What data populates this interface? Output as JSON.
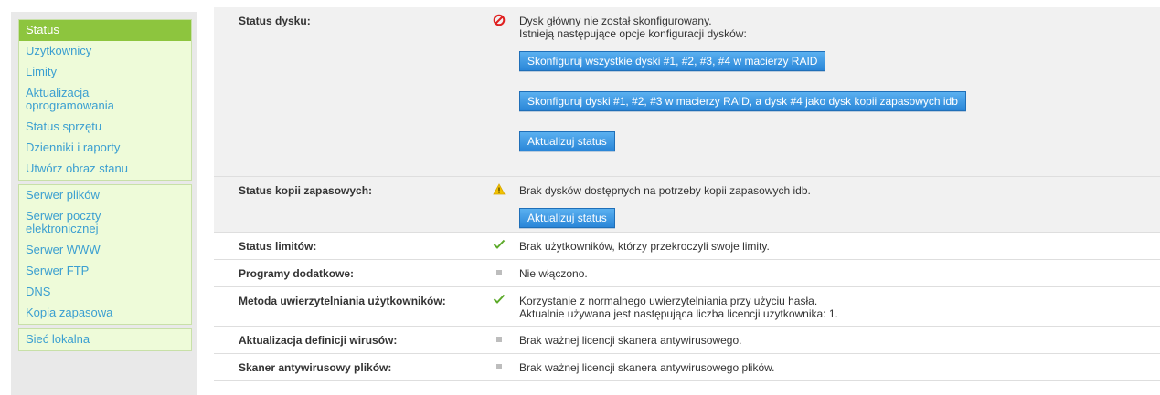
{
  "sidebar": {
    "groups": [
      {
        "items": [
          {
            "label": "Status",
            "active": true
          },
          {
            "label": "Użytkownicy"
          },
          {
            "label": "Limity"
          },
          {
            "label": "Aktualizacja\noprogramowania"
          },
          {
            "label": "Status sprzętu"
          },
          {
            "label": "Dzienniki i raporty"
          },
          {
            "label": "Utwórz obraz stanu"
          }
        ]
      },
      {
        "items": [
          {
            "label": "Serwer plików"
          },
          {
            "label": "Serwer poczty\nelektronicznej"
          },
          {
            "label": "Serwer WWW"
          },
          {
            "label": "Serwer FTP"
          },
          {
            "label": "DNS"
          },
          {
            "label": "Kopia zapasowa"
          }
        ]
      },
      {
        "items": [
          {
            "label": "Sieć lokalna"
          }
        ]
      }
    ]
  },
  "status": {
    "disk": {
      "label": "Status dysku:",
      "icon": "error-icon",
      "line1": "Dysk główny nie został skonfigurowany.",
      "line2": "Istnieją następujące opcje konfiguracji dysków:",
      "btn1": "Skonfiguruj wszystkie dyski #1, #2, #3, #4 w macierzy RAID",
      "btn2": "Skonfiguruj dyski #1, #2, #3 w macierzy RAID, a dysk #4 jako dysk kopii zapasowych idb",
      "btn3": "Aktualizuj status"
    },
    "backup": {
      "label": "Status kopii zapasowych:",
      "icon": "warning-icon",
      "text": "Brak dysków dostępnych na potrzeby kopii zapasowych idb.",
      "btn": "Aktualizuj status"
    },
    "limits": {
      "label": "Status limitów:",
      "icon": "check-icon",
      "text": "Brak użytkowników, którzy przekroczyli swoje limity."
    },
    "addons": {
      "label": "Programy dodatkowe:",
      "icon": "square-icon",
      "text": "Nie włączono."
    },
    "auth": {
      "label": "Metoda uwierzytelniania użytkowników:",
      "icon": "check-icon",
      "line1": "Korzystanie z normalnego uwierzytelniania przy użyciu hasła.",
      "line2": "Aktualnie używana jest następująca liczba licencji użytkownika: 1."
    },
    "virusdefs": {
      "label": "Aktualizacja definicji wirusów:",
      "icon": "square-icon",
      "text": "Brak ważnej licencji skanera antywirusowego."
    },
    "filescanner": {
      "label": "Skaner antywirusowy plików:",
      "icon": "square-icon",
      "text": "Brak ważnej licencji skanera antywirusowego plików."
    }
  },
  "colors": {
    "menu_link": "#3b9fd1",
    "menu_active_bg": "#8dc53e",
    "button": "#2a86d8",
    "error": "#e02020",
    "warning": "#f2c200",
    "check": "#5caa2a"
  }
}
